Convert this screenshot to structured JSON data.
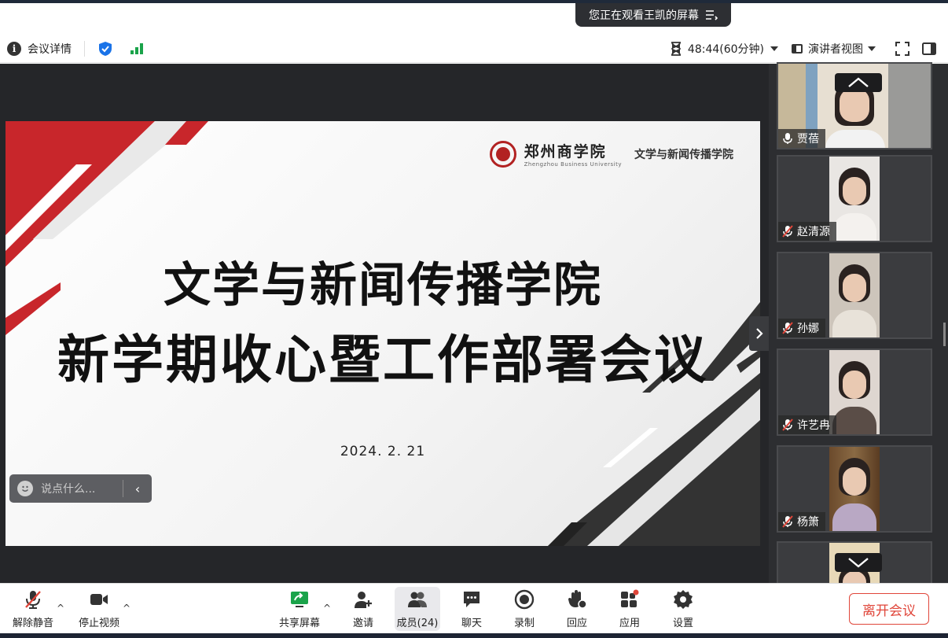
{
  "notice": {
    "text": "您正在观看王凯的屏幕"
  },
  "header": {
    "meeting_info_label": "会议详情",
    "timer": "48:44(60分钟)",
    "view_label": "演讲者视图"
  },
  "slide": {
    "university_cn": "郑州商学院",
    "university_en": "Zhengzhou Business University",
    "college": "文学与新闻传播学院",
    "title_line1": "文学与新闻传播学院",
    "title_line2": "新学期收心暨工作部署会议",
    "date": "2024. 2. 21"
  },
  "chat": {
    "placeholder": "说点什么..."
  },
  "participants": [
    {
      "name": "贾蓓",
      "muted": false
    },
    {
      "name": "赵清源",
      "muted": true
    },
    {
      "name": "孙娜",
      "muted": true
    },
    {
      "name": "许艺冉",
      "muted": true
    },
    {
      "name": "杨箫",
      "muted": true
    }
  ],
  "toolbar": {
    "unmute": "解除静音",
    "stop_video": "停止视频",
    "share_screen": "共享屏幕",
    "invite": "邀请",
    "members": "成员(24)",
    "chat": "聊天",
    "record": "录制",
    "react": "回应",
    "apps": "应用",
    "settings": "设置",
    "leave": "离开会议"
  },
  "colors": {
    "accent_red": "#c8262b",
    "leave_red": "#e0463a",
    "signal_green": "#1aa34a",
    "shield_blue": "#1a73e8"
  }
}
